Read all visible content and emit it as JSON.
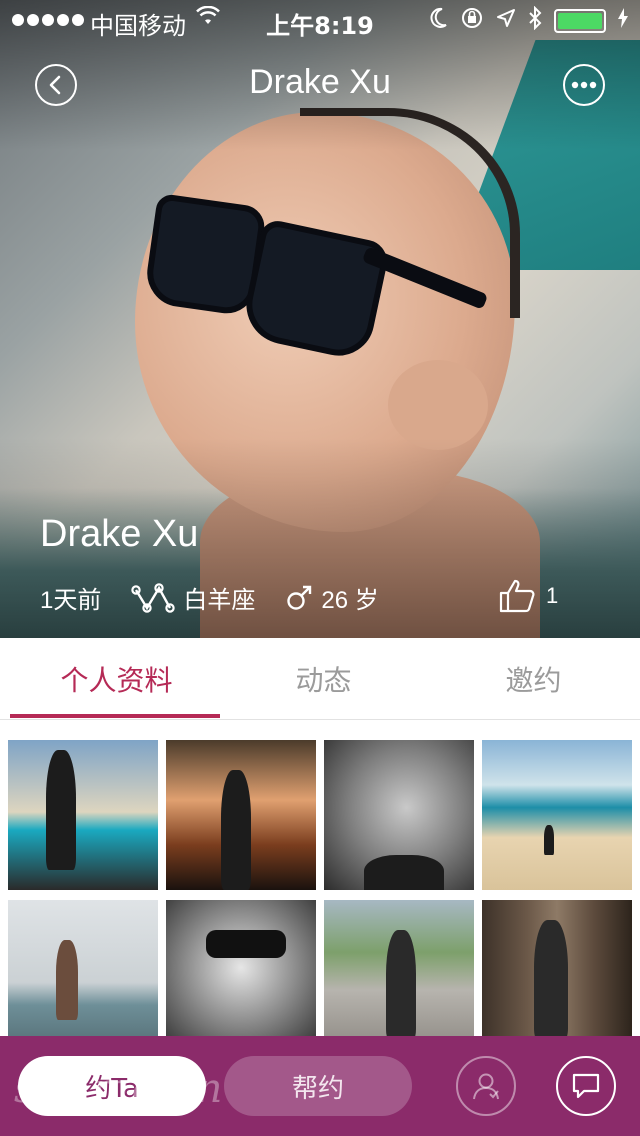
{
  "status_bar": {
    "carrier": "中国移动",
    "time": "上午8:19"
  },
  "nav": {
    "title": "Drake Xu",
    "back_icon": "chevron-left-icon",
    "more_icon": "ellipsis-icon"
  },
  "profile": {
    "name": "Drake Xu",
    "last_seen": "1天前",
    "zodiac": "白羊座",
    "age": "26 岁",
    "gender_icon": "male-icon",
    "likes": "1"
  },
  "tabs": [
    {
      "label": "个人资料",
      "active": true
    },
    {
      "label": "动态",
      "active": false
    },
    {
      "label": "邀约",
      "active": false
    }
  ],
  "gallery_count": 8,
  "bottom_bar": {
    "primary_label": "约Ta",
    "secondary_label": "帮约",
    "watermark": "sstime.cn"
  },
  "colors": {
    "accent": "#b52a56",
    "bottom_bar": "#8b2b6a",
    "battery": "#4cd964"
  }
}
